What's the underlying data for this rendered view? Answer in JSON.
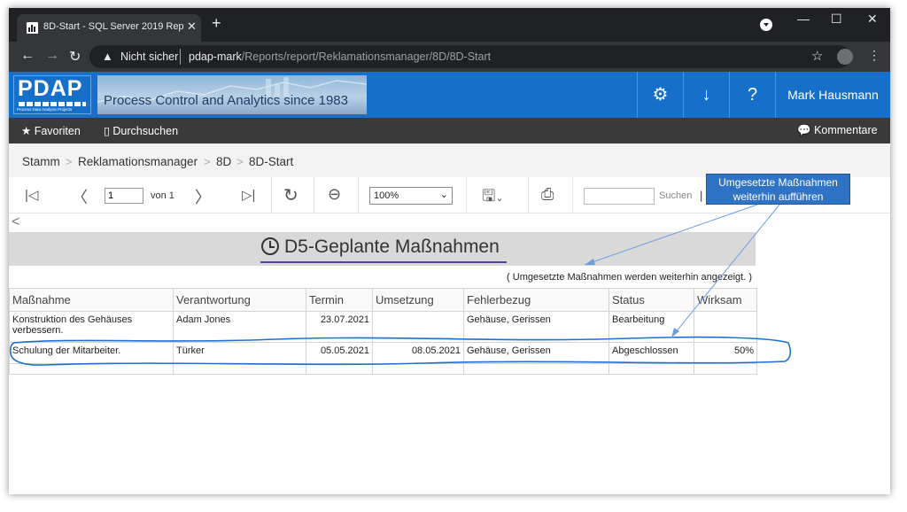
{
  "browser": {
    "tab_title": "8D-Start - SQL Server 2019 Repo",
    "tab_close": "✕",
    "new_tab": "+",
    "security_label": "Nicht sicher",
    "url_host": "pdap-mark",
    "url_path": "/Reports/report/Reklamationsmanager/8D/8D-Start",
    "minimize": "—",
    "maximize": "☐",
    "close": "✕"
  },
  "header": {
    "logo_text": "PDAP",
    "logo_sub": "Process Data Analysis Projects",
    "banner_text": "Process Control and Analytics since 1983",
    "user_name": "Mark Hausmann",
    "icons": [
      "gear-icon",
      "download-icon",
      "help-icon"
    ]
  },
  "favbar": {
    "favorites": "Favoriten",
    "browse": "Durchsuchen",
    "comments": "Kommentare"
  },
  "breadcrumb": [
    "Stamm",
    "Reklamationsmanager",
    "8D",
    "8D-Start"
  ],
  "toolbar": {
    "page_value": "1",
    "of_label": "von 1",
    "zoom_value": "100%",
    "search_label": "Suchen",
    "search_pipe": "|"
  },
  "annotation": {
    "line1": "Umgesetzte Maßnahmen",
    "line2": "weiterhin aufführen"
  },
  "report": {
    "title": "D5-Geplante Maßnahmen",
    "note": "( Umgesetzte Maßnahmen werden weiterhin angezeigt. )",
    "columns": [
      "Maßnahme",
      "Verantwortung",
      "Termin",
      "Umsetzung",
      "Fehlerbezug",
      "Status",
      "Wirksam"
    ],
    "rows": [
      {
        "massnahme": "Konstruktion des Gehäuses verbessern.",
        "verantwortung": "Adam Jones",
        "termin": "23.07.2021",
        "umsetzung": "",
        "fehlerbezug": "Gehäuse, Gerissen",
        "status": "Bearbeitung",
        "wirksam": ""
      },
      {
        "massnahme": "Schulung der Mitarbeiter.",
        "verantwortung": "Türker",
        "termin": "05.05.2021",
        "umsetzung": "08.05.2021",
        "fehlerbezug": "Gehäuse, Gerissen",
        "status": "Abgeschlossen",
        "wirksam": "50%"
      }
    ]
  },
  "colors": {
    "header_blue": "#1670c9",
    "chrome_dark": "#202124",
    "annotation_blue": "#2f74c4",
    "highlight_ring": "#1f6fd1"
  }
}
